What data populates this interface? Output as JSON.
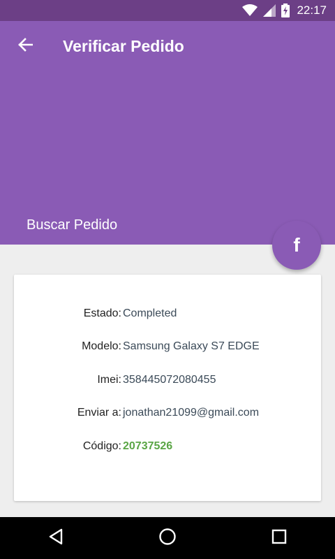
{
  "status_bar": {
    "time": "22:17",
    "icons": [
      "wifi-icon",
      "signal-icon",
      "battery-charging-icon"
    ]
  },
  "appbar": {
    "title": "Verificar Pedido",
    "back_icon": "arrow-back-icon"
  },
  "header": {
    "subtitle": "Buscar Pedido"
  },
  "fab": {
    "icon": "facebook-icon",
    "glyph": "f"
  },
  "order": {
    "rows": [
      {
        "label": "Estado:",
        "value": "Completed"
      },
      {
        "label": "Modelo:",
        "value": "Samsung Galaxy S7 EDGE"
      },
      {
        "label": "Imei:",
        "value": "358445072080455"
      },
      {
        "label": "Enviar a:",
        "value": "jonathan21099@gmail.com"
      },
      {
        "label": "Código:",
        "value": "20737526"
      }
    ]
  },
  "navbar": {
    "icons": [
      "nav-back-icon",
      "nav-home-icon",
      "nav-recents-icon"
    ]
  },
  "colors": {
    "primary": "#8a5bb5",
    "primary_dark": "#6c3f86",
    "code_green": "#5aa545",
    "background": "#eeeeee"
  }
}
